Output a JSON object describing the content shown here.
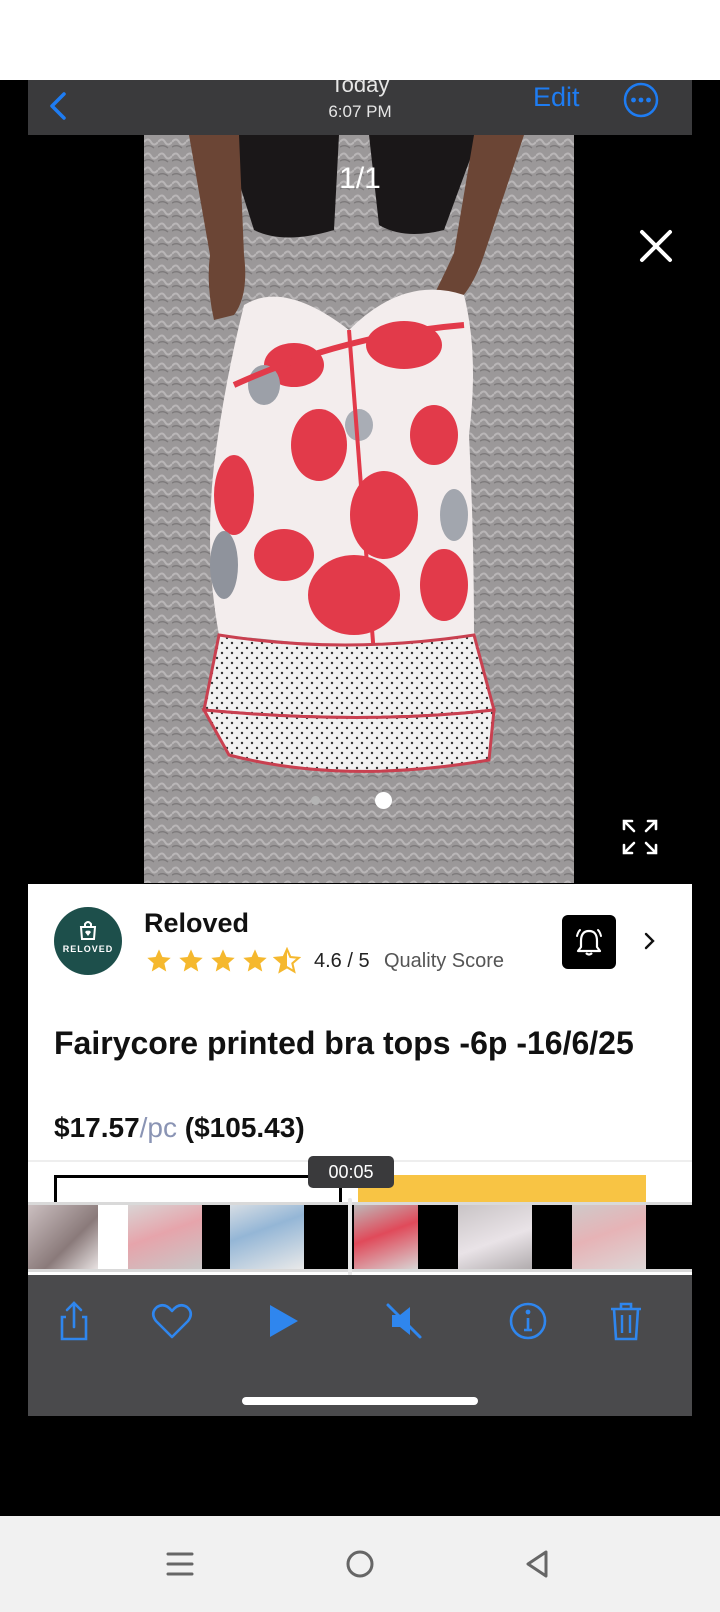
{
  "header": {
    "title": "Today",
    "time": "6:07 PM",
    "edit_label": "Edit"
  },
  "photo": {
    "counter": "1/1",
    "page_dots": 2,
    "active_dot": 2
  },
  "shop": {
    "name": "Reloved",
    "logo_text": "RELOVED",
    "rating": "4.6 / 5",
    "rating_value": 4.6,
    "rating_label": "Quality Score"
  },
  "product": {
    "title": "Fairycore printed bra tops -6p -16/6/25",
    "price": "$17.57",
    "unit": "/pc",
    "total": "($105.43)"
  },
  "video": {
    "timestamp": "00:05"
  },
  "colors": {
    "accent": "#1e7cf2",
    "star": "#f5b82e",
    "logo_bg": "#1d4f4b",
    "buy_button": "#f8c444",
    "toolbar_bg": "#4a4a4c"
  },
  "toolbar": {
    "icons": [
      "share-icon",
      "heart-icon",
      "play-icon",
      "mute-icon",
      "info-icon",
      "trash-icon"
    ]
  },
  "android_nav": {
    "icons": [
      "recents-icon",
      "home-icon",
      "back-icon"
    ]
  }
}
